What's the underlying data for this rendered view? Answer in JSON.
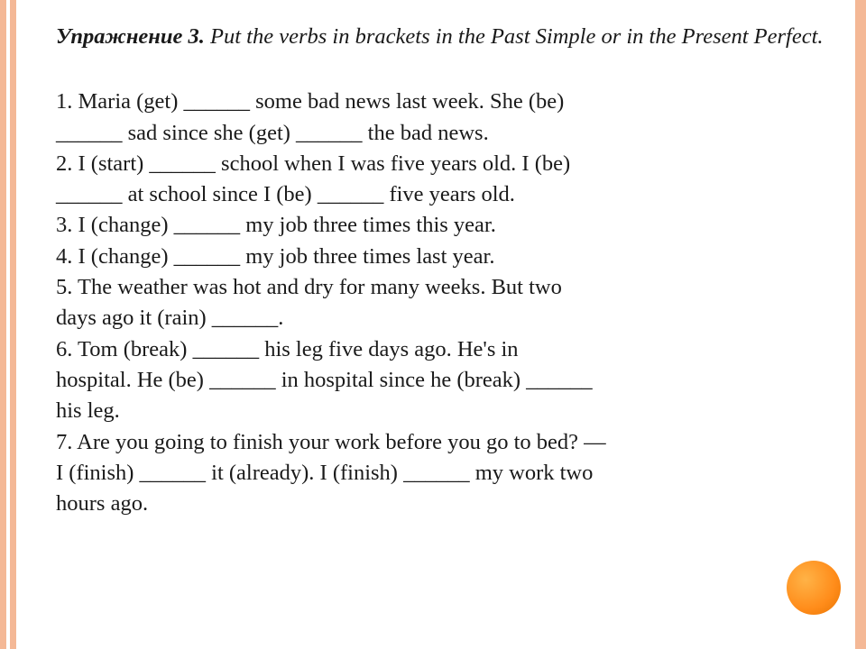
{
  "title": {
    "label": "Упражнение 3.",
    "instruction": " Put the verbs in brackets in the Past Simple or in the Present Perfect."
  },
  "exercises": {
    "line1": "1. Maria (get) ______ some bad news last week. She (be)",
    "line2": "______ sad since she (get) ______  the bad news.",
    "line3": "2. I  (start) ______  school when I was five years old. I (be)",
    "line4": "______  at school since I (be) ______  five years old.",
    "line5": "3. I  (change) ______ my job three times this year.",
    "line6": "4. I  (change) ______  my job three times last year.",
    "line7": "5.  The weather was hot and dry for many weeks. But two",
    "line8": "days ago it (rain) ______.",
    "line9": "6.  Tom (break) ______  his leg five days ago. He's in",
    "line10": "hospital. He (be) ______  in hospital since he (break) ______",
    "line11": " his leg.",
    "line12": "7.  Are you going to finish your work before you go to bed? —",
    "line13": "I (finish) ______  it (already). I (finish) ______  my work two",
    "line14": "hours ago."
  }
}
